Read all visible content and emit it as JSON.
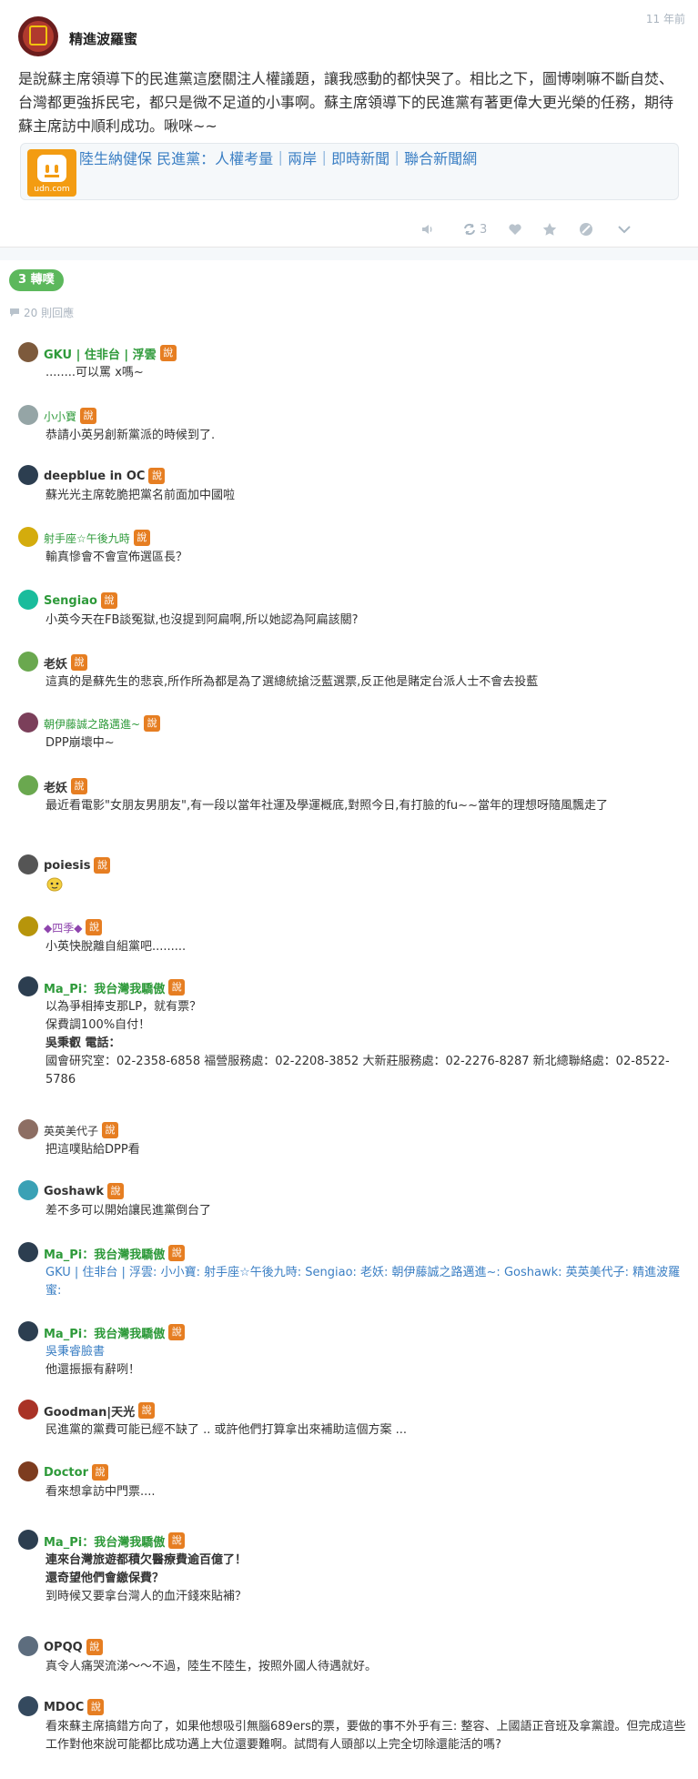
{
  "post": {
    "author": "精進波羅蜜",
    "time": "11 年前",
    "body": "是說蘇主席領導下的民進黨這麼關注人權議題，讓我感動的都快哭了。相比之下，圖博喇嘛不斷自焚、台灣都更強拆民宅，都只是微不足道的小事啊。蘇主席領導下的民進黨有著更偉大更光榮的任務，期待蘇主席訪中順利成功。啾咪~~",
    "link_title": "陸生納健保 民進黨：人權考量｜兩岸｜即時新聞｜聯合新聞網",
    "link_brand": "udn.com",
    "retweet_count": "3"
  },
  "section": {
    "retweet_label": "3 轉噗",
    "reply_count_label": "20 則回應"
  },
  "colors": {
    "green": "#5cb85c",
    "badge": "#e67e22",
    "link": "#3b7fc4"
  },
  "badge_label": "說",
  "comments": [
    {
      "name": "GKU | 住非台 | 浮雲",
      "lines": [
        "........可以罵 x嗎~"
      ]
    },
    {
      "name": "小小寶",
      "lines": [
        "恭請小英另創新黨派的時候到了."
      ]
    },
    {
      "name": "deepblue in OC",
      "lines": [
        "蘇光光主席乾脆把黨名前面加中國啦"
      ]
    },
    {
      "name": "射手座☆午後九時",
      "lines": [
        "輸真慘會不會宣佈選區長？"
      ]
    },
    {
      "name": "Sengiao",
      "lines": [
        "小英今天在FB談冤獄,也沒提到阿扁啊,所以她認為阿扁該關?"
      ]
    },
    {
      "name": "老妖",
      "lines": [
        "這真的是蘇先生的悲哀,所作所為都是為了選總統搶泛藍選票,反正他是賭定台派人士不會去投藍"
      ]
    },
    {
      "name": "朝伊藤誠之路邁進~",
      "lines": [
        "DPP崩壞中~"
      ]
    },
    {
      "name": "老妖",
      "lines": [
        "最近看電影\"女朋友男朋友\",有一段以當年社運及學運概底,對照今日,有打臉的fu~~當年的理想呀隨風飄走了"
      ]
    },
    {
      "name": "poiesis",
      "lines": []
    },
    {
      "name": "◆四季◆",
      "lines": [
        "小英快脫離自組黨吧........."
      ]
    },
    {
      "name": "Ma_Pi：我台灣我驕傲",
      "lines": [
        "以為爭相捧支那LP，就有票？",
        "保費調100%自付！",
        "吳秉叡 電話：",
        "國會研究室：02-2358-6858 福營服務處：02-2208-3852 大新莊服務處：02-2276-8287 新北總聯絡處：02-8522-5786"
      ]
    },
    {
      "name": "英英美代子",
      "lines": [
        "把這噗貼給DPP看"
      ]
    },
    {
      "name": "Goshawk",
      "lines": [
        "差不多可以開始讓民進黨倒台了"
      ]
    },
    {
      "name": "Ma_Pi：我台灣我驕傲",
      "lines": [
        "GKU | 住非台 | 浮雲: 小小寶: 射手座☆午後九時: Sengiao: 老妖: 朝伊藤誠之路邁進~: Goshawk: 英英美代子: 精進波羅蜜:"
      ]
    },
    {
      "name": "Ma_Pi：我台灣我驕傲",
      "lines": [
        "吳秉睿臉書",
        "他還振振有辭咧！"
      ]
    },
    {
      "name": "Goodman|天光",
      "lines": [
        "民進黨的黨費可能已經不缺了 .. 或許他們打算拿出來補助這個方案 ..."
      ]
    },
    {
      "name": "Doctor",
      "lines": [
        "看來想拿訪中門票...."
      ]
    },
    {
      "name": "Ma_Pi：我台灣我驕傲",
      "lines": [
        "連來台灣旅遊都積欠醫療費逾百億了！",
        "還奇望他們會繳保費？",
        "到時候又要拿台灣人的血汗錢來貼補？"
      ]
    },
    {
      "name": "OPQQ",
      "lines": [
        "真令人痛哭流涕～～不過，陸生不陸生，按照外國人待遇就好。"
      ]
    },
    {
      "name": "MDOC",
      "lines": [
        "看來蘇主席搞錯方向了，如果他想吸引無腦689ers的票，要做的事不外乎有三: 整容、上國語正音班及拿黨證。但完成這些工作對他來說可能都比成功邁上大位還要難啊。試問有人頭部以上完全切除還能活的嗎?"
      ]
    }
  ]
}
